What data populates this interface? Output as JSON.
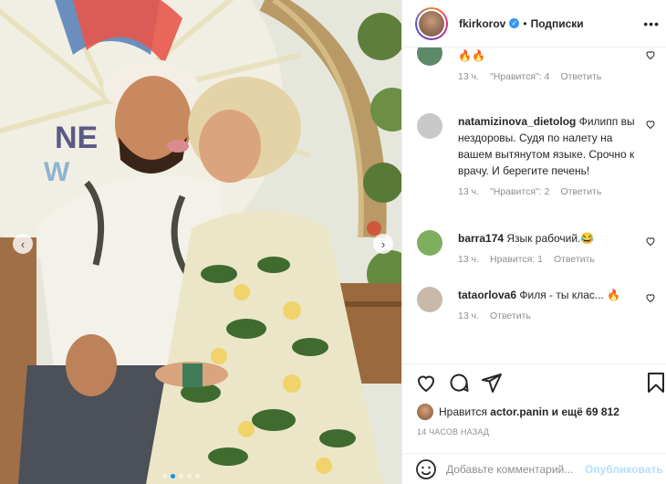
{
  "post": {
    "username": "fkirkorov",
    "separator": "•",
    "follow_label": "Подписки",
    "more_icon": "more-horizontal-icon"
  },
  "photo": {
    "sign_text_1": "NE",
    "sign_text_2": "W",
    "prev_icon": "chevron-left-icon",
    "next_icon": "chevron-right-icon"
  },
  "comments": [
    {
      "username": "",
      "text": "🔥🔥",
      "time": "13 ч.",
      "likes": "\"Нравится\": 4",
      "reply": "Ответить",
      "avatar_color": "#5f8a6a"
    },
    {
      "username": "natamizinova_dietolog",
      "text": "Филипп вы нездоровы. Судя по налету на вашем вытянутом языке. Срочно к врачу. И берегите печень!",
      "time": "13 ч.",
      "likes": "\"Нравится\": 2",
      "reply": "Ответить",
      "avatar_color": "#c7c9c7"
    },
    {
      "username": "barra174",
      "text": "Язык рабочий.😂",
      "time": "13 ч.",
      "likes": "Нравится: 1",
      "reply": "Ответить",
      "avatar_color": "#7fae5f"
    },
    {
      "username": "tataorlova6",
      "text": "Филя - ты клас... 🔥",
      "time": "13 ч.",
      "likes": "",
      "reply": "Ответить",
      "avatar_color": "#c9b9a8"
    }
  ],
  "actions": {
    "like_icon": "heart-icon",
    "comment_icon": "comment-icon",
    "share_icon": "share-icon",
    "save_icon": "bookmark-icon"
  },
  "likes": {
    "prefix": "Нравится",
    "user": "actor.panin",
    "suffix": "и ещё 69 812"
  },
  "timestamp": "14 ЧАСОВ НАЗАД",
  "add_comment": {
    "placeholder": "Добавьте комментарий...",
    "publish_label": "Опубликовать"
  },
  "colors": {
    "accent": "#0095f6",
    "verified": "#3897f0",
    "muted": "#8e8e8e"
  }
}
